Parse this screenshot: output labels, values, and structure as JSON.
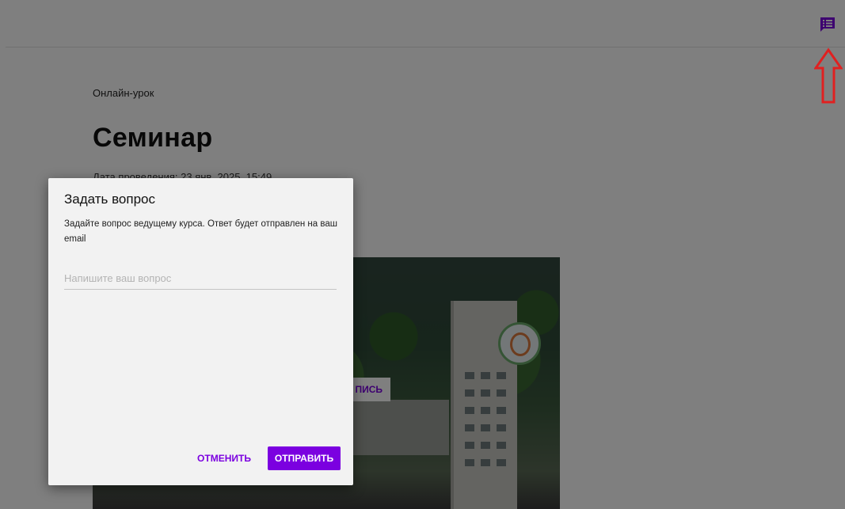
{
  "page": {
    "eyebrow": "Онлайн-урок",
    "title": "Семинар",
    "date": "Дата проведения: 23 янв. 2025, 15:49"
  },
  "header": {
    "chat_icon": "chat-list-icon",
    "accent_color": "#7b00e0"
  },
  "video": {
    "record_button_label": "ПИСЬ"
  },
  "dialog": {
    "title": "Задать вопрос",
    "description": "Задайте вопрос ведущему курса. Ответ будет отправлен на ваш email",
    "input_value": "",
    "input_placeholder": "Напишите ваш вопрос",
    "cancel_label": "ОТМЕНИТЬ",
    "submit_label": "ОТПРАВИТЬ"
  },
  "annotation": {
    "arrow_color": "#e02020",
    "arrow_icon": "up-arrow-outline-icon"
  }
}
